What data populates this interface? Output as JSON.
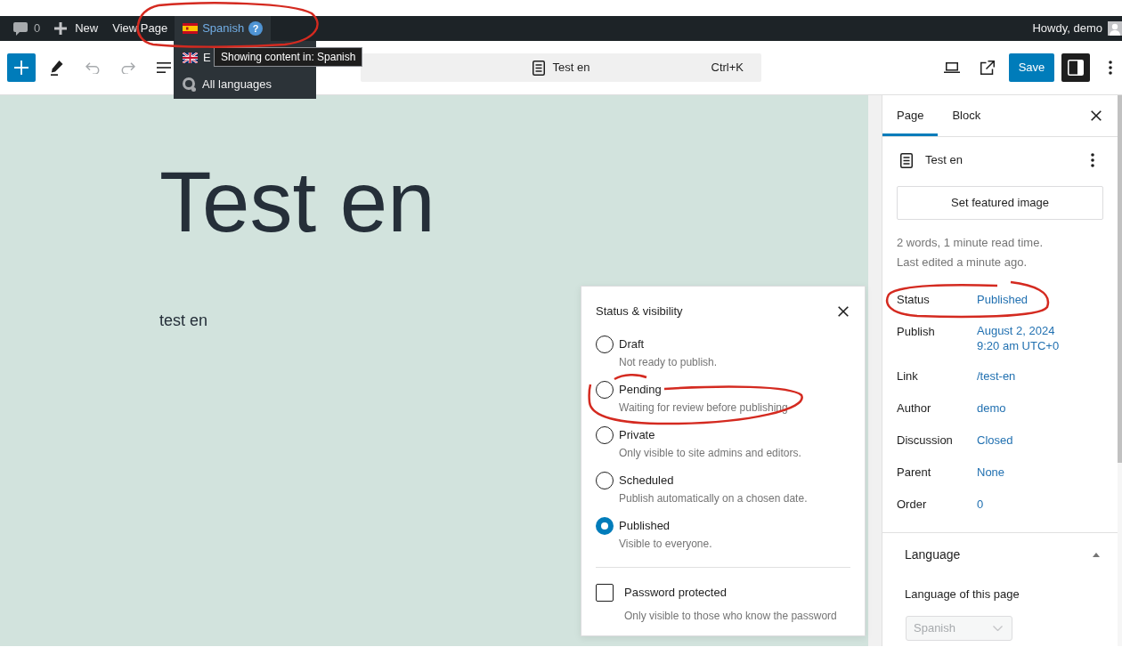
{
  "admin_bar": {
    "comments": {
      "count": "0"
    },
    "links": [
      {
        "kind": "new",
        "label": "New"
      },
      {
        "kind": "view",
        "label": "View Page"
      }
    ],
    "language_switcher": {
      "label": "Spanish",
      "help": "?"
    },
    "greeting": "Howdy, demo"
  },
  "language_menu": {
    "items": [
      {
        "kind": "uk",
        "label": "E"
      },
      {
        "kind": "all",
        "label": "All languages"
      }
    ],
    "tooltip": "Showing content in: Spanish"
  },
  "toolbar": {
    "command_bar": {
      "title": "Test en",
      "shortcut": "Ctrl+K"
    },
    "save": "Save",
    "sidebar_open": true
  },
  "canvas": {
    "title": "Test en",
    "paragraph": "test en"
  },
  "status_popover": {
    "title": "Status & visibility",
    "options": [
      {
        "label": "Draft",
        "description": "Not ready to publish.",
        "selected": false
      },
      {
        "label": "Pending",
        "description": "Waiting for review before publishing",
        "selected": false
      },
      {
        "label": "Private",
        "description": "Only visible to site admins and editors.",
        "selected": false
      },
      {
        "label": "Scheduled",
        "description": "Publish automatically on a chosen date.",
        "selected": false
      },
      {
        "label": "Published",
        "description": "Visible to everyone.",
        "selected": true
      }
    ],
    "password": {
      "label": "Password protected",
      "description": "Only visible to those who know the password",
      "checked": false
    }
  },
  "sidebar": {
    "tabs": [
      {
        "label": "Page",
        "selected": true
      },
      {
        "label": "Block",
        "selected": false
      }
    ],
    "document": {
      "title": "Test en"
    },
    "featured_image_button": "Set featured image",
    "stats": [
      "2 words, 1 minute read time.",
      "Last edited a minute ago."
    ],
    "fields": [
      {
        "label": "Status",
        "values": [
          "Published"
        ]
      },
      {
        "label": "Publish",
        "values": [
          "August 2, 2024",
          "9:20 am UTC+0"
        ]
      },
      {
        "label": "Link",
        "values": [
          "/test-en"
        ]
      },
      {
        "label": "Author",
        "values": [
          "demo"
        ]
      },
      {
        "label": "Discussion",
        "values": [
          "Closed"
        ]
      },
      {
        "label": "Parent",
        "values": [
          "None"
        ]
      },
      {
        "label": "Order",
        "values": [
          "0"
        ]
      }
    ],
    "language": {
      "title": "Language",
      "expanded": true,
      "field_label": "Language of this page",
      "select": {
        "value": "Spanish",
        "disabled": true
      }
    }
  }
}
